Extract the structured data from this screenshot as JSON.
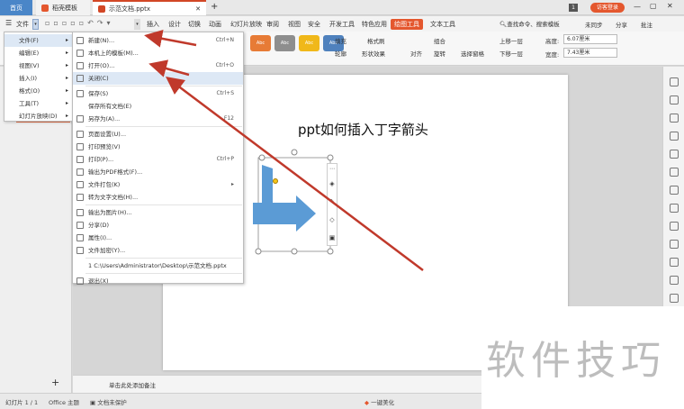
{
  "tabs": {
    "home": "首页",
    "template": "稻壳模板",
    "document": "示范文档.pptx"
  },
  "titlebar": {
    "page_badge": "1",
    "login": "访客登录"
  },
  "menubar": {
    "file": "文件",
    "tabs": [
      "插入",
      "设计",
      "切换",
      "动画",
      "幻灯片放映",
      "审阅",
      "视图",
      "安全",
      "开发工具",
      "特色应用",
      "绘图工具",
      "文本工具"
    ],
    "active_tab": "绘图工具",
    "search": "查找命令、搜索模板",
    "sync": "未同步",
    "share": "分享",
    "comment": "批注"
  },
  "ribbon": {
    "style_buttons": [
      "Abc",
      "Abc",
      "Abc",
      "Abc"
    ],
    "style_colors": [
      "#e77b36",
      "#8e8e8e",
      "#f0b81a",
      "#4f81bd"
    ],
    "fill": "填充",
    "format_painter": "格式刷",
    "outline": "轮廓",
    "shape_effect": "形状效果",
    "align": "对齐",
    "group": "组合",
    "rotate": "旋转",
    "select_pane": "选择窗格",
    "up_layer": "上移一层",
    "down_layer": "下移一层",
    "height_label": "高度:",
    "height_value": "6.07厘米",
    "width_label": "宽度:",
    "width_value": "7.43厘米"
  },
  "menu_main": [
    {
      "label": "文件(F)",
      "has_sub": true
    },
    {
      "label": "编辑(E)",
      "has_sub": true
    },
    {
      "label": "视图(V)",
      "has_sub": true
    },
    {
      "label": "插入(I)",
      "has_sub": true
    },
    {
      "label": "格式(O)",
      "has_sub": true
    },
    {
      "label": "工具(T)",
      "has_sub": true
    },
    {
      "label": "幻灯片放映(D)",
      "has_sub": true
    }
  ],
  "menu_file": [
    {
      "label": "新建(N)...",
      "shortcut": "Ctrl+N",
      "icon": "new-doc-icon"
    },
    {
      "label": "本机上的模板(M)...",
      "shortcut": "",
      "icon": "template-icon"
    },
    {
      "label": "打开(O)...",
      "shortcut": "Ctrl+O",
      "icon": "open-folder-icon"
    },
    {
      "label": "关闭(C)",
      "shortcut": "",
      "icon": "close-doc-icon"
    },
    {
      "label": "保存(S)",
      "shortcut": "Ctrl+S",
      "icon": "save-icon"
    },
    {
      "label": "保存所有文档(E)",
      "shortcut": "",
      "icon": ""
    },
    {
      "label": "另存为(A)...",
      "shortcut": "F12",
      "icon": "save-as-icon"
    },
    {
      "label": "页面设置(U)...",
      "shortcut": "",
      "icon": "page-setup-icon"
    },
    {
      "label": "打印预览(V)",
      "shortcut": "",
      "icon": "print-preview-icon"
    },
    {
      "label": "打印(P)...",
      "shortcut": "Ctrl+P",
      "icon": "print-icon"
    },
    {
      "label": "输出为PDF格式(F)...",
      "shortcut": "",
      "icon": "pdf-icon"
    },
    {
      "label": "文件打包(K)",
      "shortcut": "",
      "icon": "package-icon",
      "has_sub": true
    },
    {
      "label": "转为文字文档(H)...",
      "shortcut": "",
      "icon": "convert-icon"
    },
    {
      "label": "输出为图片(H)...",
      "shortcut": "",
      "icon": "image-export-icon"
    },
    {
      "label": "分享(D)",
      "shortcut": "",
      "icon": "share-icon"
    },
    {
      "label": "属性(I)...",
      "shortcut": "",
      "icon": "properties-icon"
    },
    {
      "label": "文件加密(Y)...",
      "shortcut": "",
      "icon": "encrypt-icon"
    },
    {
      "label": "1 C:\\Users\\Administrator\\Desktop\\示范文档.pptx",
      "shortcut": "",
      "icon": ""
    },
    {
      "label": "退出(X)",
      "shortcut": "",
      "icon": "exit-icon"
    }
  ],
  "slide": {
    "title": "ppt如何插入丁字箭头"
  },
  "panel": {
    "add": "+"
  },
  "notes": {
    "placeholder": "单击此处添加备注"
  },
  "statusbar": {
    "slide_count": "幻灯片 1 / 1",
    "theme": "Office 主题",
    "protect": "文档未保护",
    "beautify": "一键美化"
  },
  "watermark": {
    "text": "软件技巧"
  },
  "colors": {
    "accent": "#e4572e",
    "arrow_blue": "#5b9bd5",
    "annotation_red": "#c0392b"
  }
}
